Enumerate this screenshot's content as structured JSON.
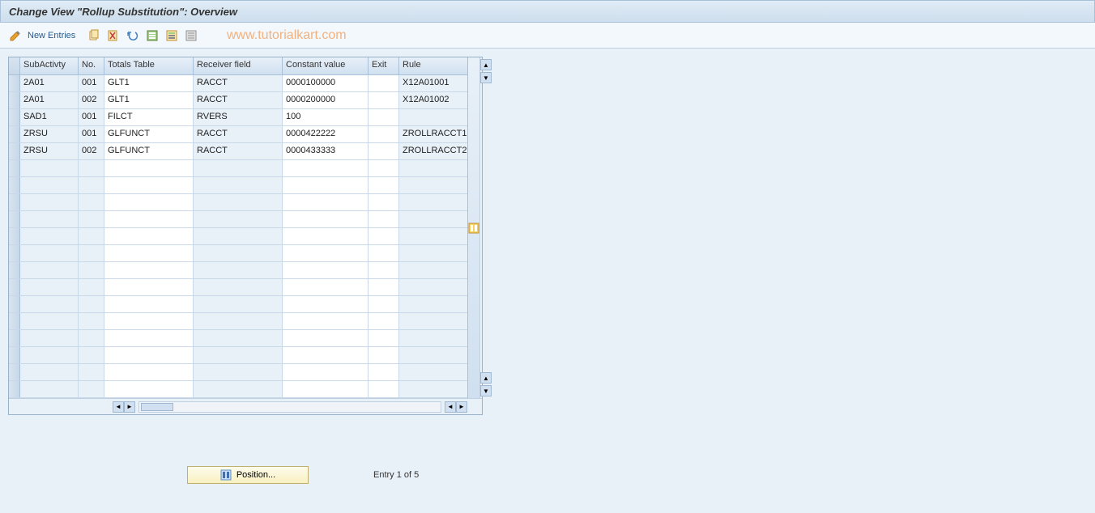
{
  "header": {
    "title": "Change View \"Rollup Substitution\": Overview"
  },
  "toolbar": {
    "new_entries_label": "New Entries"
  },
  "watermark": "www.tutorialkart.com",
  "table": {
    "columns": {
      "subactivity": "SubActivty",
      "no": "No.",
      "totals_table": "Totals Table",
      "receiver_field": "Receiver field",
      "constant_value": "Constant value",
      "exit": "Exit",
      "rule": "Rule"
    },
    "rows": [
      {
        "subactivity": "2A01",
        "no": "001",
        "totals": "GLT1",
        "receiver": "RACCT",
        "constant": "0000100000",
        "exit": "",
        "rule": "X12A01001"
      },
      {
        "subactivity": "2A01",
        "no": "002",
        "totals": "GLT1",
        "receiver": "RACCT",
        "constant": "0000200000",
        "exit": "",
        "rule": "X12A01002"
      },
      {
        "subactivity": "SAD1",
        "no": "001",
        "totals": "FILCT",
        "receiver": "RVERS",
        "constant": "100",
        "exit": "",
        "rule": ""
      },
      {
        "subactivity": "ZRSU",
        "no": "001",
        "totals": "GLFUNCT",
        "receiver": "RACCT",
        "constant": "0000422222",
        "exit": "",
        "rule": "ZROLLRACCT1"
      },
      {
        "subactivity": "ZRSU",
        "no": "002",
        "totals": "GLFUNCT",
        "receiver": "RACCT",
        "constant": "0000433333",
        "exit": "",
        "rule": "ZROLLRACCT2"
      }
    ],
    "empty_rows": 14
  },
  "footer": {
    "position_label": "Position...",
    "entry_text": "Entry 1 of 5"
  }
}
